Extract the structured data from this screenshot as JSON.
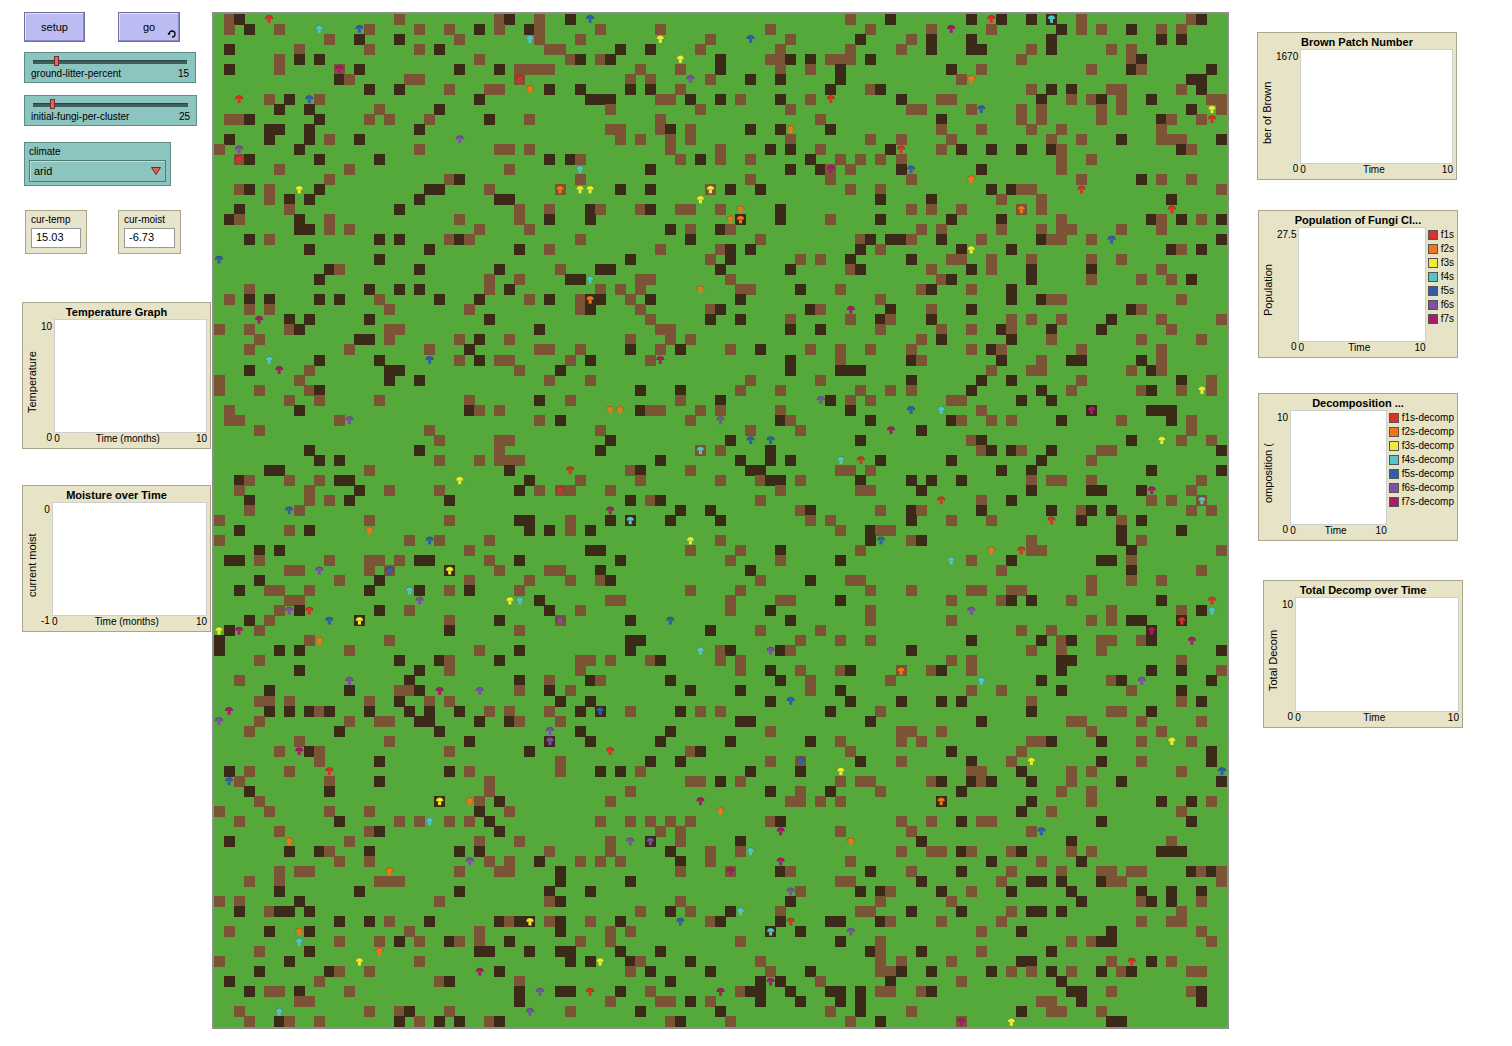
{
  "buttons": [
    {
      "label": "setup",
      "forever": false
    },
    {
      "label": "go",
      "forever": true
    }
  ],
  "sliders": [
    {
      "label": "ground-litter-percent",
      "value": "15",
      "level": 0.15
    },
    {
      "label": "initial-fungi-per-cluster",
      "value": "25",
      "level": 0.12
    }
  ],
  "chooser": {
    "label": "climate",
    "value": "arid"
  },
  "monitors": [
    {
      "label": "cur-temp",
      "value": "15.03"
    },
    {
      "label": "cur-moist",
      "value": "-6.73"
    }
  ],
  "plots": [
    {
      "title": "Temperature Graph",
      "y_label": "Temperature",
      "y_max": "10",
      "y_min": "0",
      "x_min": "0",
      "x_label": "Time (months)",
      "x_max": "10",
      "legend": false,
      "series": []
    },
    {
      "title": "Moisture over Time",
      "y_label": "current moist",
      "y_max": "0",
      "y_min": "-1",
      "x_min": "0",
      "x_label": "Time (months)",
      "x_max": "10",
      "legend": false,
      "series": []
    },
    {
      "title": "Brown Patch Number",
      "y_label": "ber of Brown",
      "y_max": "1670",
      "y_min": "0",
      "x_min": "0",
      "x_label": "Time",
      "x_max": "10",
      "legend": false,
      "series": []
    },
    {
      "title": "Population of Fungi Cl...",
      "y_label": "Population",
      "y_max": "27.5",
      "y_min": "0",
      "x_min": "0",
      "x_label": "Time",
      "x_max": "10",
      "legend": true,
      "series": [
        {
          "name": "f1s",
          "color": "#d73229",
          "values": []
        },
        {
          "name": "f2s",
          "color": "#f1751b",
          "values": []
        },
        {
          "name": "f3s",
          "color": "#eded31",
          "values": []
        },
        {
          "name": "f4s",
          "color": "#54c4c4",
          "values": []
        },
        {
          "name": "f5s",
          "color": "#345da9",
          "values": []
        },
        {
          "name": "f6s",
          "color": "#7c50a4",
          "values": []
        },
        {
          "name": "f7s",
          "color": "#a71b6a",
          "values": []
        }
      ]
    },
    {
      "title": "Decomposition ...",
      "y_label": "omposition (",
      "y_max": "10",
      "y_min": "0",
      "x_min": "0",
      "x_label": "Time",
      "x_max": "10",
      "legend": true,
      "series": [
        {
          "name": "f1s-decomp",
          "color": "#d73229",
          "values": []
        },
        {
          "name": "f2s-decomp",
          "color": "#f1751b",
          "values": []
        },
        {
          "name": "f3s-decomp",
          "color": "#eded31",
          "values": []
        },
        {
          "name": "f4s-decomp",
          "color": "#54c4c4",
          "values": []
        },
        {
          "name": "f5s-decomp",
          "color": "#345da9",
          "values": []
        },
        {
          "name": "f6s-decomp",
          "color": "#7c50a4",
          "values": []
        },
        {
          "name": "f7s-decomp",
          "color": "#a71b6a",
          "values": []
        }
      ]
    },
    {
      "title": "Total Decomp over Time",
      "y_label": "Total Decom",
      "y_max": "10",
      "y_min": "0",
      "x_min": "0",
      "x_label": "Time",
      "x_max": "10",
      "legend": false,
      "series": []
    }
  ],
  "world": {
    "patches": 101,
    "seed": 20240611,
    "brown_share": 0.09,
    "dark_brown_share": 0.07,
    "patch_colors": {
      "ground": "#55a83a",
      "litter": "#7a5434",
      "old_litter": "#3c2a18"
    },
    "fungi": [
      {
        "name": "f1s",
        "color": "#d73229",
        "count": 25
      },
      {
        "name": "f2s",
        "color": "#f1751b",
        "count": 25
      },
      {
        "name": "f3s",
        "color": "#eded31",
        "count": 25
      },
      {
        "name": "f4s",
        "color": "#54c4c4",
        "count": 25
      },
      {
        "name": "f5s",
        "color": "#345da9",
        "count": 25
      },
      {
        "name": "f6s",
        "color": "#7c50a4",
        "count": 25
      },
      {
        "name": "f7s",
        "color": "#a71b6a",
        "count": 25
      }
    ]
  }
}
